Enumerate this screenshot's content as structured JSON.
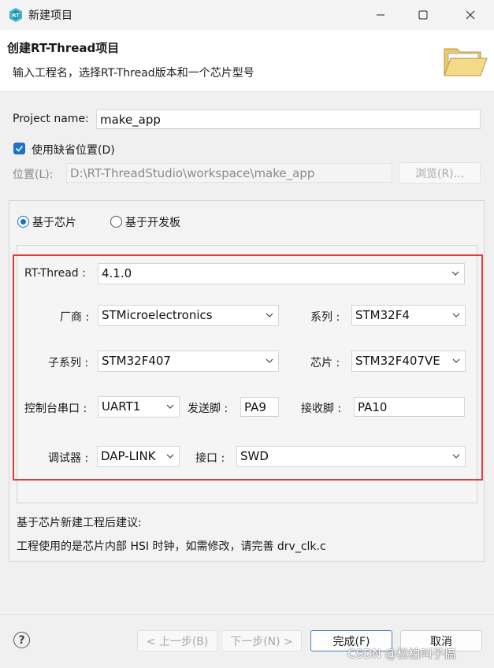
{
  "window": {
    "title": "新建项目",
    "controls": [
      "minimize-icon",
      "maximize-icon",
      "close-icon"
    ]
  },
  "header": {
    "title": "创建RT-Thread项目",
    "description": "输入工程名，选择RT-Thread版本和一个芯片型号"
  },
  "project": {
    "name_label": "Project name:",
    "name_value": "make_app",
    "use_default_label": "使用缺省位置(D)",
    "use_default_checked": true,
    "location_label": "位置(L):",
    "location_value": "D:\\RT-ThreadStudio\\workspace\\make_app",
    "browse_label": "浏览(R)..."
  },
  "mode": {
    "chip_label": "基于芯片",
    "board_label": "基于开发板",
    "selected": "chip"
  },
  "config": {
    "rtthread_label": "RT-Thread :",
    "rtthread_value": "4.1.0",
    "vendor_label": "厂商 :",
    "vendor_value": "STMicroelectronics",
    "series_label": "系列 :",
    "series_value": "STM32F4",
    "subseries_label": "子系列 :",
    "subseries_value": "STM32F407",
    "chip_label": "芯片 :",
    "chip_value": "STM32F407VE",
    "console_label": "控制台串口 :",
    "console_value": "UART1",
    "tx_label": "发送脚 :",
    "tx_value": "PA9",
    "rx_label": "接收脚 :",
    "rx_value": "PA10",
    "debugger_label": "调试器 :",
    "debugger_value": "DAP-LINK",
    "interface_label": "接口 :",
    "interface_value": "SWD"
  },
  "advice": {
    "title": "基于芯片新建工程后建议:",
    "text": "工程使用的是芯片内部 HSI 时钟，如需修改，请完善 drv_clk.c"
  },
  "footer": {
    "help_glyph": "?",
    "back_label": "< 上一步(B)",
    "next_label": "下一步(N) >",
    "finish_label": "完成(F)",
    "cancel_label": "取消"
  },
  "watermark": "CSDN @松柏叫子搞",
  "colors": {
    "accent": "#1a73c8",
    "highlight_box": "#e5393a"
  }
}
